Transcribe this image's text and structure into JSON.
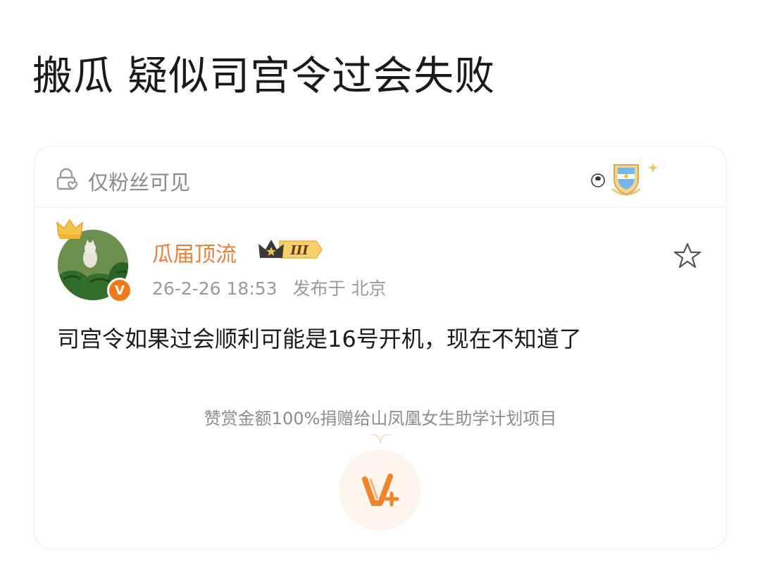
{
  "headline": "搬瓜 疑似司宫令过会失败",
  "card": {
    "visibility_label": "仅粉丝可见",
    "user": {
      "name": "瓜届顶流",
      "level_badge": "III",
      "verified_mark": "V"
    },
    "timestamp": "26-2-26 18:53",
    "location": "发布于 北京",
    "post_text": "司宫令如果过会顺利可能是16号开机，现在不知道了",
    "reward_text": "赞赏金额100%捐赠给山凤凰女生助学计划项目"
  },
  "icons": {
    "visibility": "lock-heart-icon",
    "favorite": "star-icon",
    "reward": "v-plus-icon",
    "crown": "crown-icon",
    "badge": "argentina-shield-icon"
  },
  "colors": {
    "username": "#e8813a",
    "accent_orange": "#f07a1a",
    "muted_text": "#8a8a8a"
  }
}
